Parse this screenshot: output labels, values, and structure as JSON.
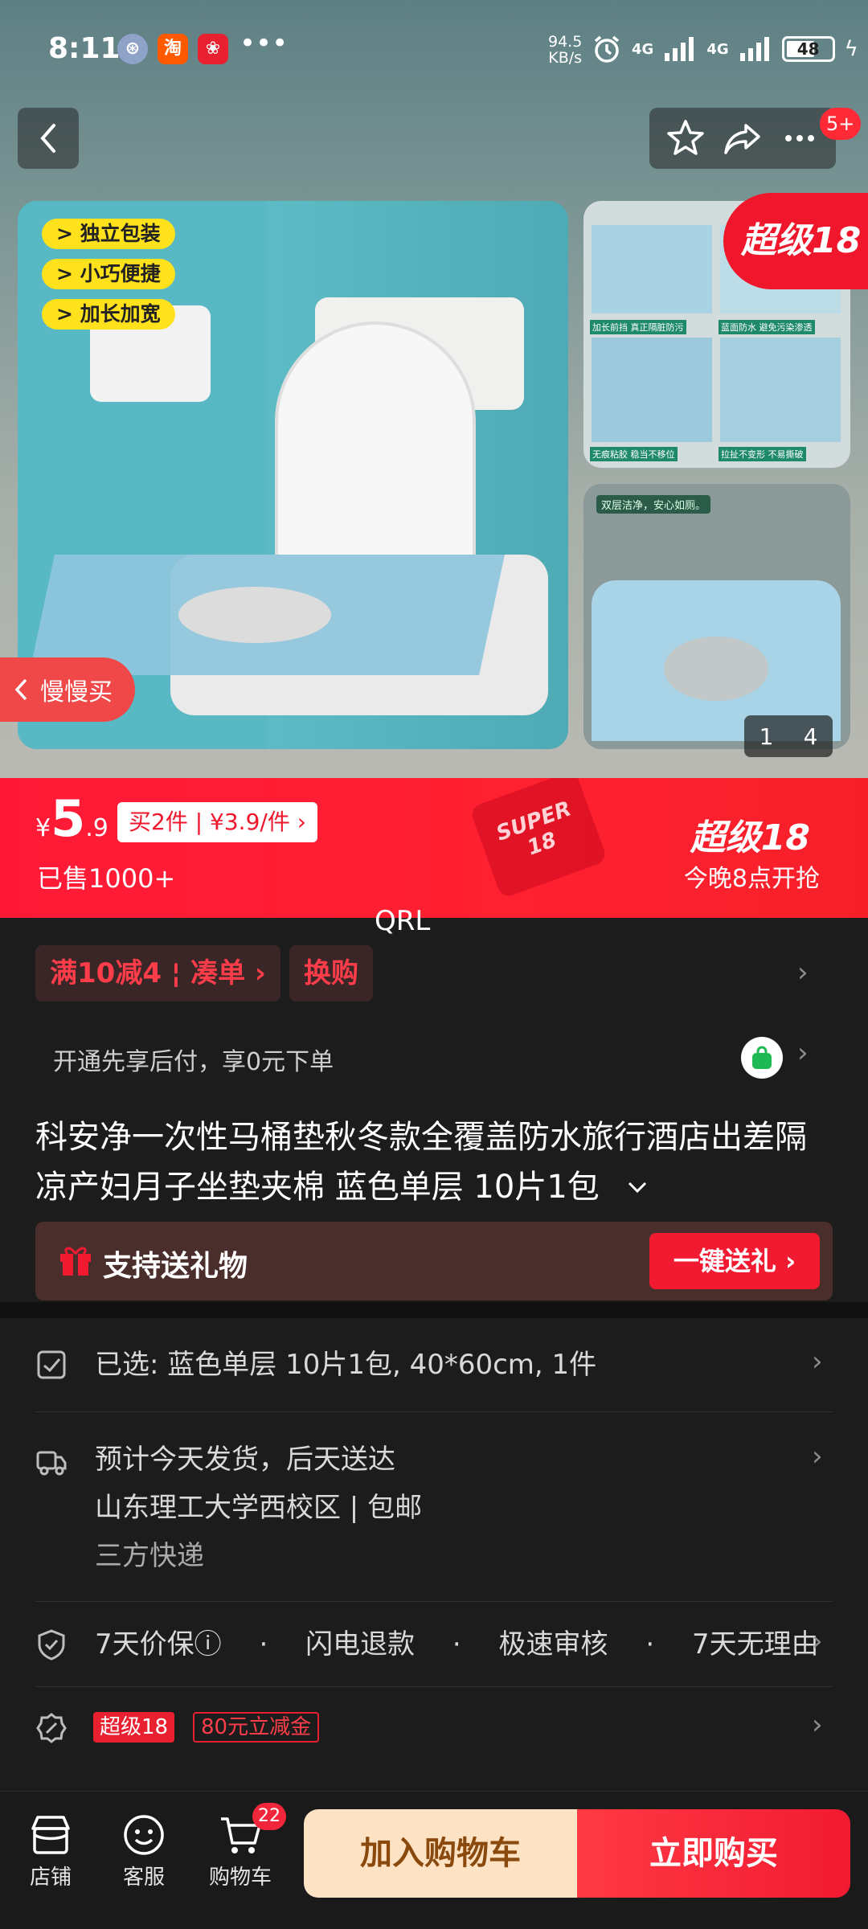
{
  "status_bar": {
    "time": "8:11",
    "app_icons": [
      "steering-icon",
      "淘",
      "gift-icon"
    ],
    "more": "•••",
    "net_speed_value": "94.5",
    "net_speed_unit": "KB/s",
    "signal_1": "4G",
    "signal_2": "4G",
    "battery": "48"
  },
  "header": {
    "notification_badge": "5+"
  },
  "gallery": {
    "tags": [
      "> 独立包装",
      "> 小巧便捷",
      "> 加长加宽"
    ],
    "super_badge": "超级18",
    "slow_buy": "慢慢买",
    "page_current": "1",
    "page_total": "4",
    "side_caption_1": "加长前挡 真正隔脏防污",
    "side_caption_2": "蓝面防水 避免污染渗透",
    "side_caption_3": "无痕粘胶 稳当不移位",
    "side_caption_4": "拉扯不变形 不易撕破",
    "side_caption_5": "双层洁净，安心如厕。"
  },
  "price": {
    "currency": "¥",
    "integer": "5",
    "decimal": ".9",
    "multi_buy": "买2件 | ¥3.9/件 ›",
    "sold": "已售1000+",
    "event_title": "超级18",
    "event_sub": "今晚8点开抢",
    "deco_text": "SUPER 18"
  },
  "overlay_text": "QRL",
  "promos": {
    "tag1": "满10减4 ¦ 凑单 ›",
    "tag2": "换购"
  },
  "paylater": "开通先享后付，享0元下单",
  "product_title": "科安净一次性马桶垫秋冬款全覆盖防水旅行酒店出差隔凉产妇月子坐垫夹棉 蓝色单层 10片1包",
  "gift": {
    "label": "支持送礼物",
    "button": "一键送礼 ›"
  },
  "selected": "已选: 蓝色单层 10片1包, 40*60cm, 1件",
  "shipping": {
    "line1": "预计今天发货，后天送达",
    "line2": "山东理工大学西校区 | 包邮",
    "line3": "三方快递"
  },
  "services": [
    "7天价保ⓘ",
    "·",
    "闪电退款",
    "·",
    "极速审核",
    "·",
    "7天无理由"
  ],
  "coupons": {
    "tag1": "超级18",
    "tag2": "80元立减金"
  },
  "bottom_bar": {
    "shop": "店铺",
    "service": "客服",
    "cart": "购物车",
    "cart_count": "22",
    "add_to_cart": "加入购物车",
    "buy_now": "立即购买"
  },
  "colors": {
    "accent_red": "#f11a31",
    "cart_button_bg": "#fde2c4",
    "background": "#1c1c1c"
  }
}
